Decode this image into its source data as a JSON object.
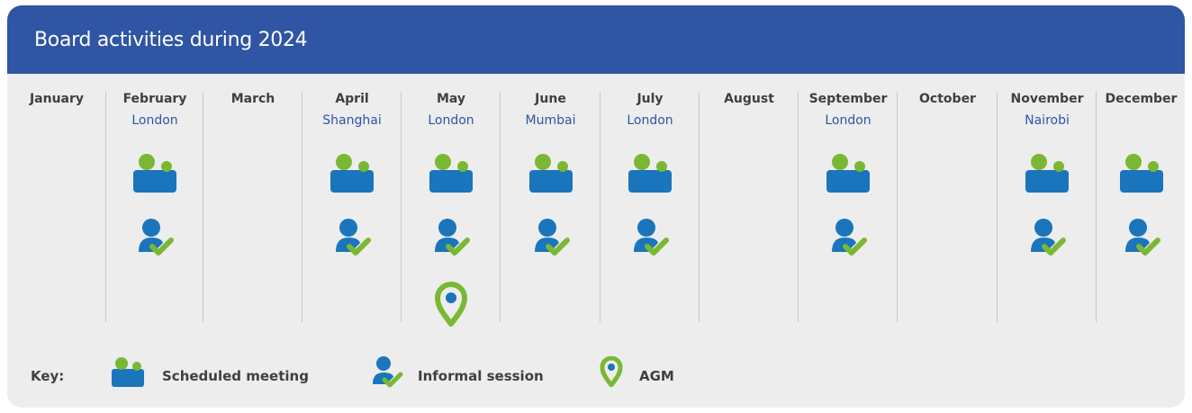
{
  "title": "Board activities during 2024",
  "months": [
    {
      "name": "January",
      "location": "",
      "scheduled_meeting": false,
      "informal_session": false,
      "agm": false
    },
    {
      "name": "February",
      "location": "London",
      "scheduled_meeting": true,
      "informal_session": true,
      "agm": false
    },
    {
      "name": "March",
      "location": "",
      "scheduled_meeting": false,
      "informal_session": false,
      "agm": false
    },
    {
      "name": "April",
      "location": "Shanghai",
      "scheduled_meeting": true,
      "informal_session": true,
      "agm": false
    },
    {
      "name": "May",
      "location": "London",
      "scheduled_meeting": true,
      "informal_session": true,
      "agm": true
    },
    {
      "name": "June",
      "location": "Mumbai",
      "scheduled_meeting": true,
      "informal_session": true,
      "agm": false
    },
    {
      "name": "July",
      "location": "London",
      "scheduled_meeting": true,
      "informal_session": true,
      "agm": false
    },
    {
      "name": "August",
      "location": "",
      "scheduled_meeting": false,
      "informal_session": false,
      "agm": false
    },
    {
      "name": "September",
      "location": "London",
      "scheduled_meeting": true,
      "informal_session": true,
      "agm": false
    },
    {
      "name": "October",
      "location": "",
      "scheduled_meeting": false,
      "informal_session": false,
      "agm": false
    },
    {
      "name": "November",
      "location": "Nairobi",
      "scheduled_meeting": true,
      "informal_session": true,
      "agm": false
    },
    {
      "name": "December",
      "location": "",
      "scheduled_meeting": true,
      "informal_session": true,
      "agm": false
    }
  ],
  "key": {
    "label": "Key:",
    "scheduled_meeting": "Scheduled meeting",
    "informal_session": "Informal session",
    "agm": "AGM"
  },
  "colors": {
    "header": "#2f55a4",
    "icon_blue": "#1a75bc",
    "icon_green": "#7ab833",
    "location_text": "#2f55a4",
    "background": "#ededed"
  },
  "icons": {
    "scheduled_meeting": "people-meeting-icon",
    "informal_session": "person-check-icon",
    "agm": "map-pin-icon"
  }
}
